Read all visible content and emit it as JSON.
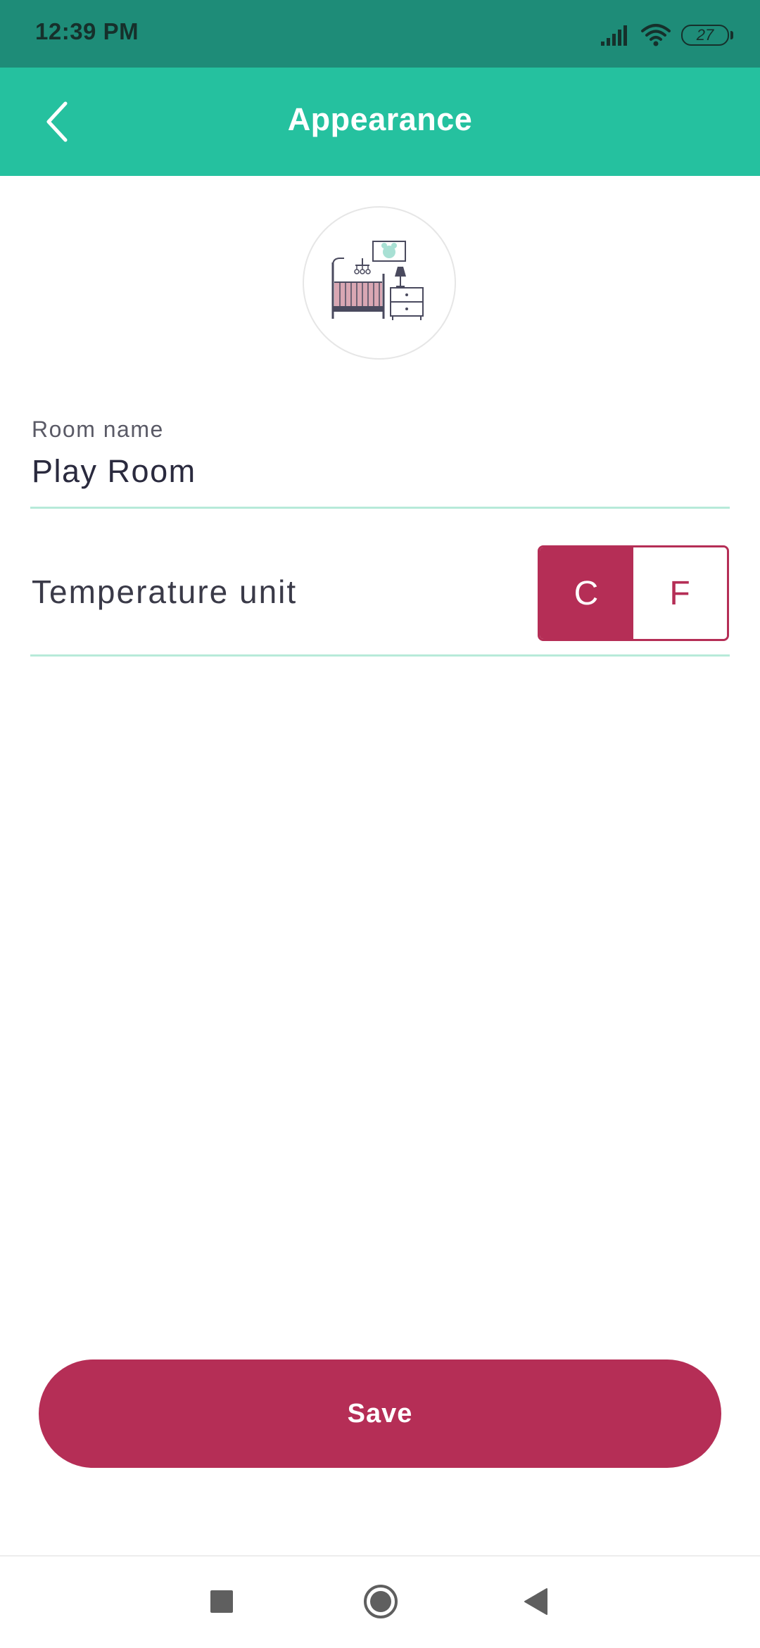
{
  "status_bar": {
    "time": "12:39 PM",
    "battery": "27",
    "icons": [
      "signal-icon",
      "wifi-icon",
      "battery-icon"
    ]
  },
  "header": {
    "title": "Appearance",
    "back_icon": "chevron-left-icon"
  },
  "room": {
    "image_icon": "nursery-room-icon",
    "name_label": "Room name",
    "name_value": "Play Room"
  },
  "temperature": {
    "label": "Temperature unit",
    "options": [
      "C",
      "F"
    ],
    "selected": "C"
  },
  "actions": {
    "save_label": "Save"
  },
  "nav_bar": {
    "icons": [
      "recents-square-icon",
      "home-circle-icon",
      "back-triangle-icon"
    ]
  },
  "colors": {
    "status_bar": "#1e8c78",
    "app_bar": "#25c19f",
    "accent": "#b52e56",
    "divider": "#b7ead9"
  }
}
